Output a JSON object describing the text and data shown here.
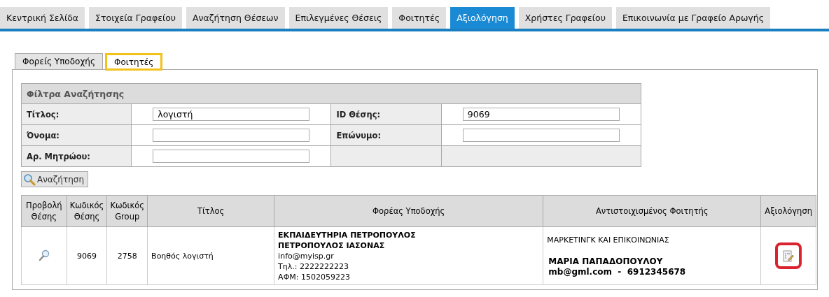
{
  "main_tabs": [
    {
      "label": "Κεντρική Σελίδα",
      "selected": false
    },
    {
      "label": "Στοιχεία Γραφείου",
      "selected": false
    },
    {
      "label": "Αναζήτηση Θέσεων",
      "selected": false
    },
    {
      "label": "Επιλεγμένες Θέσεις",
      "selected": false
    },
    {
      "label": "Φοιτητές",
      "selected": false
    },
    {
      "label": "Αξιολόγηση",
      "selected": true
    },
    {
      "label": "Χρήστες Γραφείου",
      "selected": false
    },
    {
      "label": "Επικοινωνία με Γραφείο Αρωγής",
      "selected": false
    }
  ],
  "sub_tabs": [
    {
      "label": "Φορείς Υποδοχής",
      "selected": false
    },
    {
      "label": "Φοιτητές",
      "selected": true
    }
  ],
  "filters": {
    "title": "Φίλτρα Αναζήτησης",
    "rows": [
      [
        {
          "label": "Τίτλος:",
          "value": "λογιστή"
        },
        {
          "label": "ID Θέσης:",
          "value": "9069"
        }
      ],
      [
        {
          "label": "Όνομα:"
        },
        {
          "label": "Επώνυμο:"
        }
      ],
      [
        {
          "label": "Αρ. Μητρώου:"
        }
      ]
    ]
  },
  "search_button": "Αναζήτηση",
  "results": {
    "columns": [
      [
        "Προβολή",
        "Θέσης"
      ],
      [
        "Κωδικός",
        "Θέσης"
      ],
      [
        "Κωδικός",
        "Group"
      ],
      [
        "Τίτλος"
      ],
      [
        "Φορέας Υποδοχής"
      ],
      [
        "Αντιστοιχισμένος Φοιτητής"
      ],
      [
        "Αξιολόγηση"
      ]
    ],
    "rows": [
      {
        "code": "9069",
        "group": "2758",
        "title": "Βοηθός λογιστή",
        "host": {
          "name": "ΕΚΠΑΙΔΕΥΤΗΡΙΑ ΠΕΤΡΟΠΟΥΛΟΣ",
          "contact": "ΠΕΤΡΟΠΟΥΛΟΣ ΙΑΣΟΝΑΣ",
          "email": "info@myisp.gr",
          "phone": "Τηλ.: 2222222223",
          "tax_id": "ΑΦΜ: 1502059223"
        },
        "student": {
          "department": "ΜΑΡΚΕΤΙΝΓΚ ΚΑΙ ΕΠΙΚΟΙΝΩΝΙΑΣ",
          "name": "ΜΑΡΙΑ ΠΑΠΑΔΟΠΟΥΛΟΥ",
          "contact": "mb@gml.com  -  6912345678"
        },
        "evaluate_highlighted": true
      }
    ]
  }
}
